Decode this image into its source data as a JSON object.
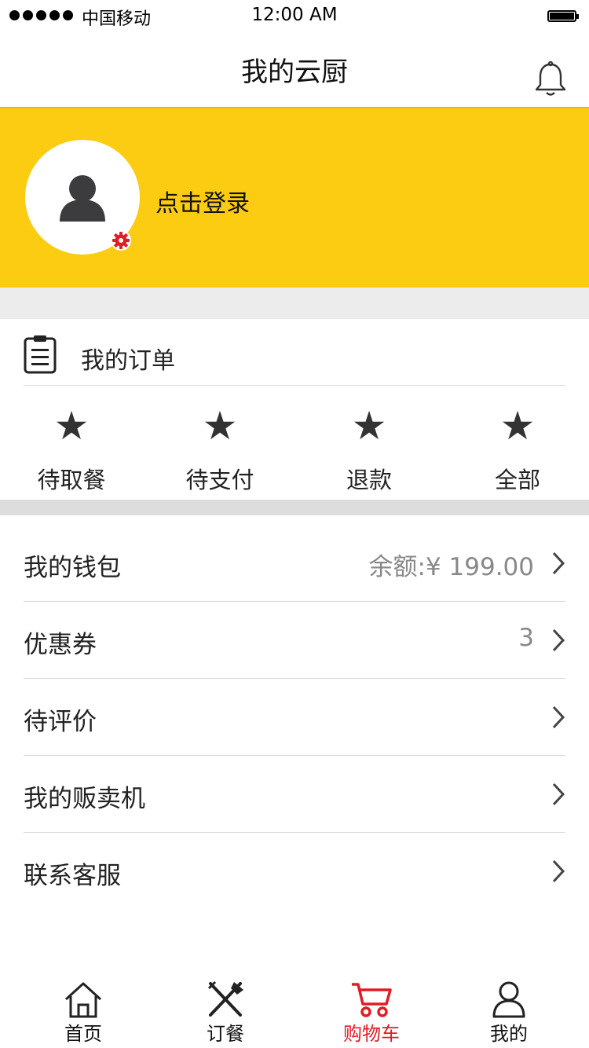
{
  "status_bar": {
    "carrier": "中国移动",
    "time": "12:00 AM"
  },
  "nav": {
    "title": "我的云厨"
  },
  "profile": {
    "login_text": "点击登录",
    "accent": "#fccc12"
  },
  "orders": {
    "title": "我的订单",
    "items": [
      {
        "label": "待取餐",
        "icon": "star-icon"
      },
      {
        "label": "待支付",
        "icon": "star-icon"
      },
      {
        "label": "退款",
        "icon": "star-icon"
      },
      {
        "label": "全部",
        "icon": "star-icon"
      }
    ]
  },
  "menu": [
    {
      "label": "我的钱包",
      "value": "余额:¥ 199.00"
    },
    {
      "label": "优惠券",
      "value": "3"
    },
    {
      "label": "待评价",
      "value": ""
    },
    {
      "label": "我的贩卖机",
      "value": ""
    },
    {
      "label": "联系客服",
      "value": ""
    }
  ],
  "tabs": [
    {
      "label": "首页",
      "icon": "home-icon"
    },
    {
      "label": "订餐",
      "icon": "utensils-icon"
    },
    {
      "label": "购物车",
      "icon": "cart-icon",
      "active": true
    },
    {
      "label": "我的",
      "icon": "user-icon"
    }
  ],
  "colors": {
    "active_tab": "#e11c24",
    "gear": "#e11c24"
  }
}
